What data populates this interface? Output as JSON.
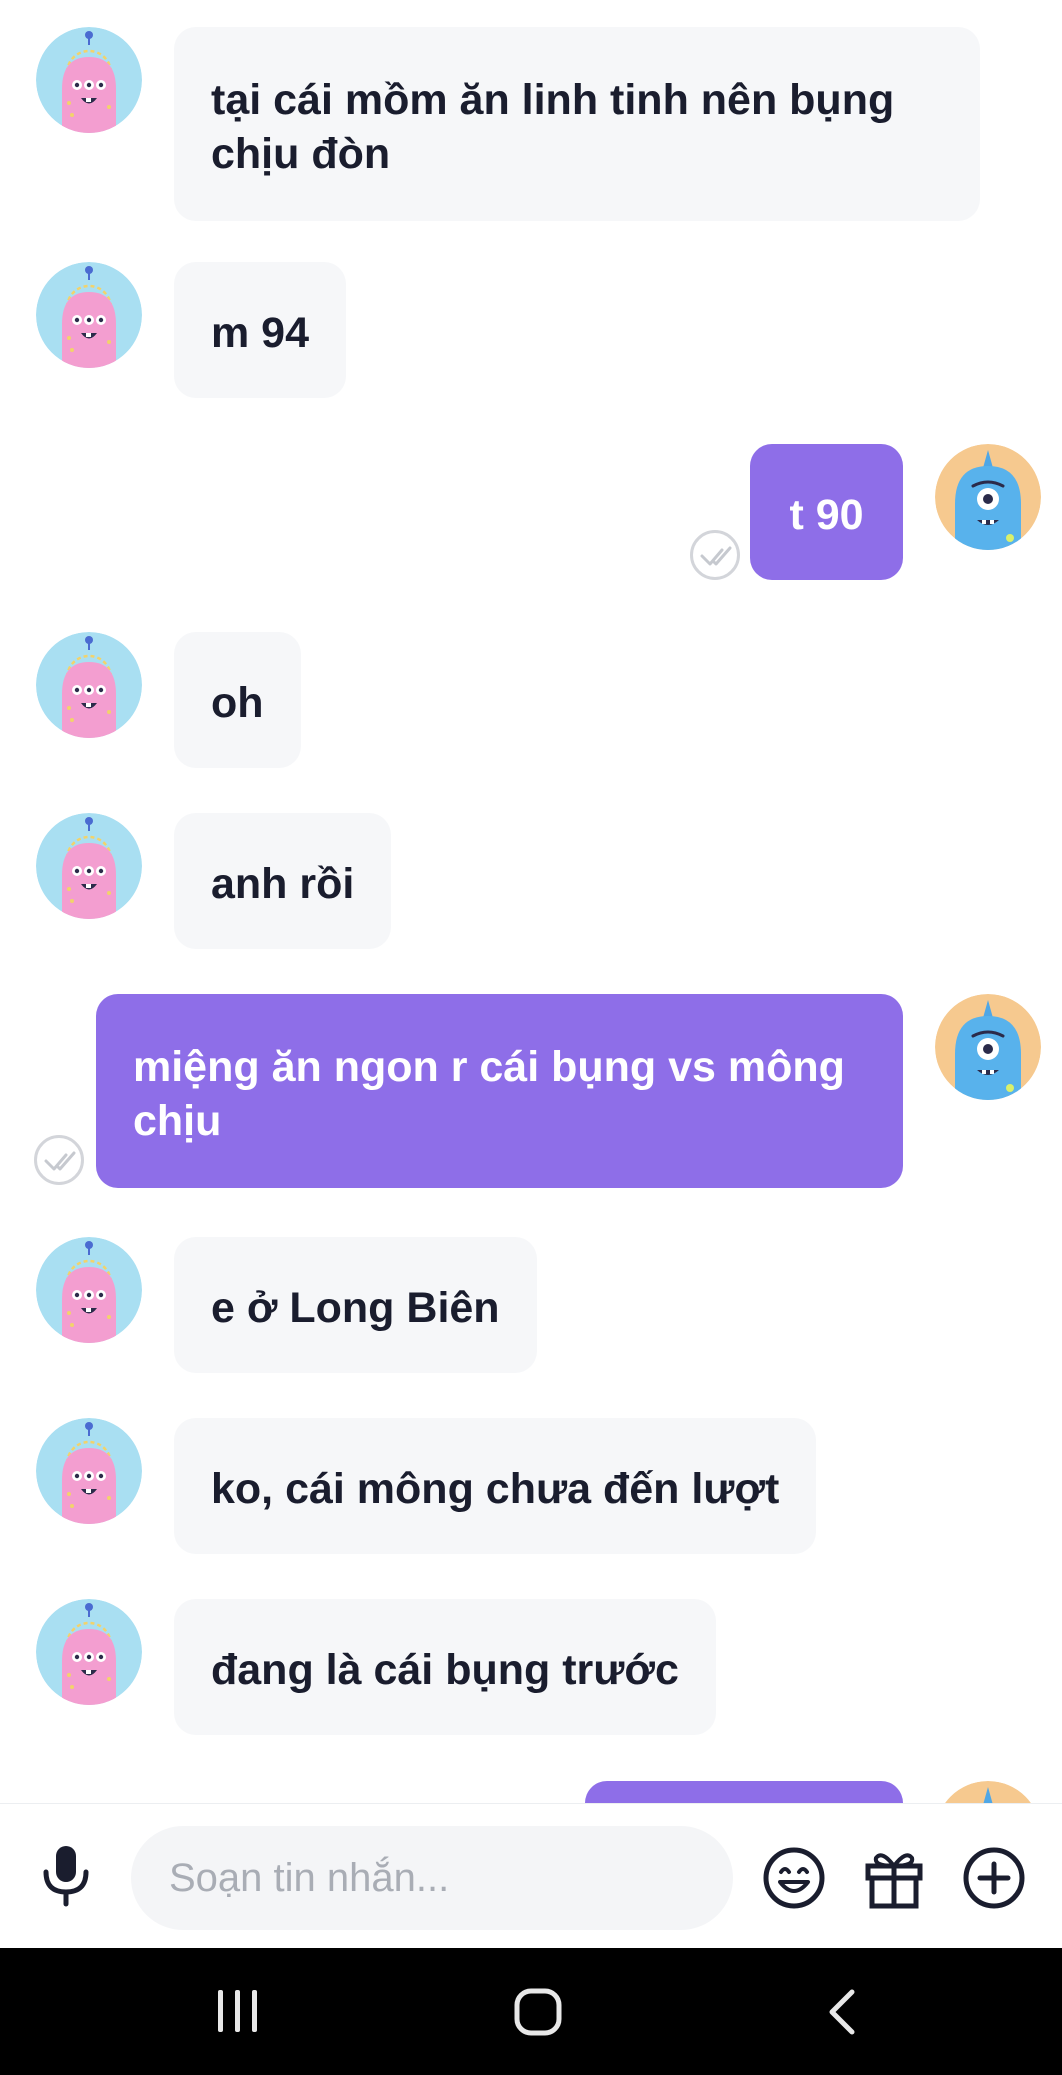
{
  "messages": [
    {
      "id": 1,
      "sender": "other",
      "text": "tại cái mồm ăn linh tinh nên bụng chịu đòn"
    },
    {
      "id": 2,
      "sender": "other",
      "text": "m 94"
    },
    {
      "id": 3,
      "sender": "me",
      "text": "t 90",
      "status": "delivered"
    },
    {
      "id": 4,
      "sender": "other",
      "text": "oh"
    },
    {
      "id": 5,
      "sender": "other",
      "text": "anh rồi"
    },
    {
      "id": 6,
      "sender": "me",
      "text": "miệng ăn ngon r cái bụng vs mông chịu",
      "status": "delivered"
    },
    {
      "id": 7,
      "sender": "other",
      "text": "e ở Long Biên"
    },
    {
      "id": 8,
      "sender": "other",
      "text": "ko, cái mông chưa đến lượt"
    },
    {
      "id": 9,
      "sender": "other",
      "text": "đang là cái bụng trước"
    }
  ],
  "composer": {
    "placeholder": "Soạn tin nhắn...",
    "icons": [
      "microphone-icon",
      "emoji-icon",
      "gift-icon",
      "add-icon"
    ]
  },
  "colors": {
    "outgoing_bubble": "#8e6ee8",
    "incoming_bubble": "#f6f7f9",
    "incoming_text": "#1a1d2e",
    "nav_bar": "#000000"
  },
  "nav_bar": {
    "buttons": [
      "recent-apps-icon",
      "home-icon",
      "back-icon"
    ]
  }
}
